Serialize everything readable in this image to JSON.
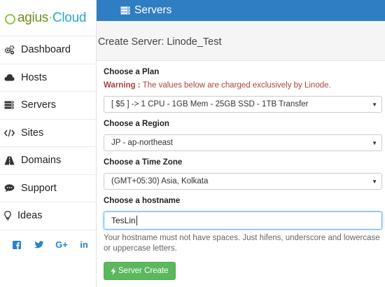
{
  "app": {
    "logo_part1": "agius",
    "logo_dot": "·",
    "logo_part2": "Cloud"
  },
  "sidebar": {
    "items": [
      {
        "label": "Dashboard",
        "icon": "gears-icon"
      },
      {
        "label": "Hosts",
        "icon": "cloud-icon"
      },
      {
        "label": "Servers",
        "icon": "server-icon"
      },
      {
        "label": "Sites",
        "icon": "code-icon"
      },
      {
        "label": "Domains",
        "icon": "road-icon"
      },
      {
        "label": "Support",
        "icon": "chat-icon"
      },
      {
        "label": "Ideas",
        "icon": "lightbulb-icon"
      }
    ],
    "social": [
      "f",
      "t",
      "G+",
      "in"
    ]
  },
  "header": {
    "title": "Servers",
    "icon": "server-icon"
  },
  "page": {
    "title": "Create Server: Linode_Test"
  },
  "form": {
    "plan_label": "Choose a Plan",
    "warning_prefix": "Warning :",
    "warning_text": " The values below are charged exclusively by Linode.",
    "plan_value": "[ $5 ] -> 1 CPU - 1GB Mem - 25GB SSD - 1TB Transfer",
    "region_label": "Choose a Region",
    "region_value": "JP - ap-northeast",
    "timezone_label": "Choose a Time Zone",
    "timezone_value": "(GMT+05:30) Asia, Kolkata",
    "hostname_label": "Choose a hostname",
    "hostname_value": "TesLin",
    "hostname_help": "Your hostname must not have spaces. Just hifens, underscore and lowercase or uppercase letters.",
    "submit_label": "Server Create"
  },
  "colors": {
    "header": "#2f7dc3",
    "button": "#5cb85c",
    "warning": "#a94442",
    "social": "#2b82c9"
  }
}
